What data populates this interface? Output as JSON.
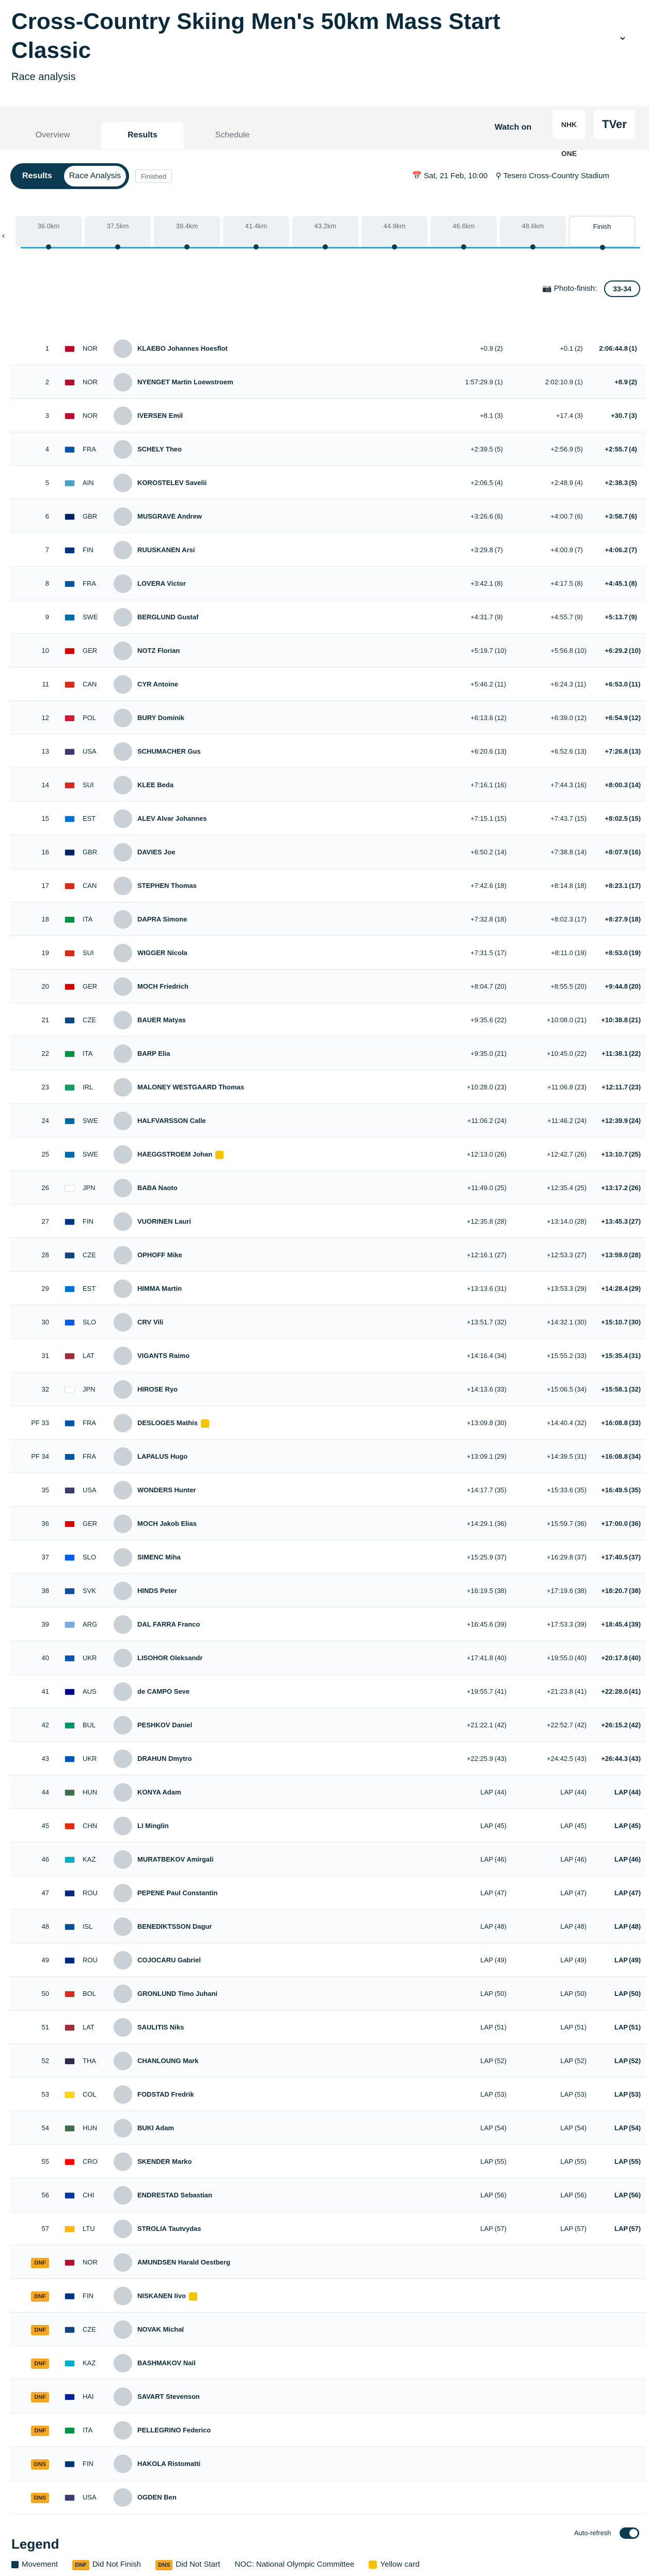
{
  "header": {
    "title": "Cross-Country Skiing Men's 50km Mass Start Classic",
    "subtitle": "Race analysis",
    "collapse_icon": "chevron-down-icon"
  },
  "tabs": [
    "Overview",
    "Results",
    "Schedule"
  ],
  "watch": {
    "label": "Watch on",
    "logo1": "NHK ONE",
    "logo2": "TVer"
  },
  "toolbar": {
    "view_results": "Results",
    "view_analysis": "Race Analysis",
    "status": "Finished",
    "date": "Sat, 21 Feb, 10:00",
    "venue": "Tesero Cross-Country Stadium"
  },
  "splits": [
    "36.0km",
    "37.5km",
    "39.4km",
    "41.4km",
    "43.2km",
    "44.9km",
    "46.6km",
    "48.6km",
    "Finish"
  ],
  "photo_finish": {
    "label": "Photo-finish:",
    "button": "33-34"
  },
  "results": [
    {
      "rank": "1",
      "noc": "NOR",
      "name": "KLAEBO Johannes Hoesflot",
      "mid": "+0.9",
      "midr": "(2)",
      "late": "+0.1",
      "later": "(2)",
      "fin": "2:06:44.8",
      "finr": "(1)",
      "flag": "#ba0c2f"
    },
    {
      "rank": "2",
      "noc": "NOR",
      "name": "NYENGET Martin Loewstroem",
      "mid": "1:57:29.9",
      "midr": "(1)",
      "late": "2:02:10.9",
      "later": "(1)",
      "fin": "+8.9",
      "finr": "(2)",
      "flag": "#ba0c2f"
    },
    {
      "rank": "3",
      "noc": "NOR",
      "name": "IVERSEN Emil",
      "mid": "+8.1",
      "midr": "(3)",
      "late": "+17.4",
      "later": "(3)",
      "fin": "+30.7",
      "finr": "(3)",
      "flag": "#ba0c2f"
    },
    {
      "rank": "4",
      "noc": "FRA",
      "name": "SCHELY Theo",
      "mid": "+2:39.5",
      "midr": "(5)",
      "late": "+2:56.9",
      "later": "(5)",
      "fin": "+2:55.7",
      "finr": "(4)",
      "flag": "#0055a4"
    },
    {
      "rank": "5",
      "noc": "AIN",
      "name": "KOROSTELEV Savelii",
      "mid": "+2:06.5",
      "midr": "(4)",
      "late": "+2:48.9",
      "later": "(4)",
      "fin": "+2:38.3",
      "finr": "(5)",
      "flag": "#4aa3c7"
    },
    {
      "rank": "6",
      "noc": "GBR",
      "name": "MUSGRAVE Andrew",
      "mid": "+3:26.6",
      "midr": "(6)",
      "late": "+4:00.7",
      "later": "(6)",
      "fin": "+3:58.7",
      "finr": "(6)",
      "flag": "#012169"
    },
    {
      "rank": "7",
      "noc": "FIN",
      "name": "RUUSKANEN Arsi",
      "mid": "+3:29.8",
      "midr": "(7)",
      "late": "+4:00.9",
      "later": "(7)",
      "fin": "+4:06.2",
      "finr": "(7)",
      "flag": "#003580"
    },
    {
      "rank": "8",
      "noc": "FRA",
      "name": "LOVERA Victor",
      "mid": "+3:42.1",
      "midr": "(8)",
      "late": "+4:17.5",
      "later": "(8)",
      "fin": "+4:45.1",
      "finr": "(8)",
      "flag": "#0055a4"
    },
    {
      "rank": "9",
      "noc": "SWE",
      "name": "BERGLUND Gustaf",
      "mid": "+4:31.7",
      "midr": "(9)",
      "late": "+4:55.7",
      "later": "(9)",
      "fin": "+5:13.7",
      "finr": "(9)",
      "flag": "#006aa7"
    },
    {
      "rank": "10",
      "noc": "GER",
      "name": "NOTZ Florian",
      "mid": "+5:19.7",
      "midr": "(10)",
      "late": "+5:56.8",
      "later": "(10)",
      "fin": "+6:29.2",
      "finr": "(10)",
      "flag": "#dd0000"
    },
    {
      "rank": "11",
      "noc": "CAN",
      "name": "CYR Antoine",
      "mid": "+5:46.2",
      "midr": "(11)",
      "late": "+6:24.3",
      "later": "(11)",
      "fin": "+6:53.0",
      "finr": "(11)",
      "flag": "#d52b1e"
    },
    {
      "rank": "12",
      "noc": "POL",
      "name": "BURY Dominik",
      "mid": "+6:13.6",
      "midr": "(12)",
      "late": "+6:39.0",
      "later": "(12)",
      "fin": "+6:54.9",
      "finr": "(12)",
      "flag": "#dc143c"
    },
    {
      "rank": "13",
      "noc": "USA",
      "name": "SCHUMACHER Gus",
      "mid": "+6:20.6",
      "midr": "(13)",
      "late": "+6:52.6",
      "later": "(13)",
      "fin": "+7:26.8",
      "finr": "(13)",
      "flag": "#3c3b6e"
    },
    {
      "rank": "14",
      "noc": "SUI",
      "name": "KLEE Beda",
      "mid": "+7:16.1",
      "midr": "(16)",
      "late": "+7:44.3",
      "later": "(16)",
      "fin": "+8:00.3",
      "finr": "(14)",
      "flag": "#d52b1e"
    },
    {
      "rank": "15",
      "noc": "EST",
      "name": "ALEV Alvar Johannes",
      "mid": "+7:15.1",
      "midr": "(15)",
      "late": "+7:43.7",
      "later": "(15)",
      "fin": "+8:02.5",
      "finr": "(15)",
      "flag": "#0072ce"
    },
    {
      "rank": "16",
      "noc": "GBR",
      "name": "DAVIES Joe",
      "mid": "+6:50.2",
      "midr": "(14)",
      "late": "+7:38.8",
      "later": "(14)",
      "fin": "+8:07.9",
      "finr": "(16)",
      "flag": "#012169"
    },
    {
      "rank": "17",
      "noc": "CAN",
      "name": "STEPHEN Thomas",
      "mid": "+7:42.6",
      "midr": "(18)",
      "late": "+8:14.8",
      "later": "(18)",
      "fin": "+8:23.1",
      "finr": "(17)",
      "flag": "#d52b1e"
    },
    {
      "rank": "18",
      "noc": "ITA",
      "name": "DAPRA Simone",
      "mid": "+7:32.8",
      "midr": "(18)",
      "late": "+8:02.3",
      "later": "(17)",
      "fin": "+8:27.9",
      "finr": "(18)",
      "flag": "#009246"
    },
    {
      "rank": "19",
      "noc": "SUI",
      "name": "WIGGER Nicola",
      "mid": "+7:31.5",
      "midr": "(17)",
      "late": "+8:11.0",
      "later": "(19)",
      "fin": "+8:53.0",
      "finr": "(19)",
      "flag": "#d52b1e"
    },
    {
      "rank": "20",
      "noc": "GER",
      "name": "MOCH Friedrich",
      "mid": "+8:04.7",
      "midr": "(20)",
      "late": "+8:55.5",
      "later": "(20)",
      "fin": "+9:44.8",
      "finr": "(20)",
      "flag": "#dd0000"
    },
    {
      "rank": "21",
      "noc": "CZE",
      "name": "BAUER Matyas",
      "mid": "+9:35.6",
      "midr": "(22)",
      "late": "+10:08.0",
      "later": "(21)",
      "fin": "+10:38.8",
      "finr": "(21)",
      "flag": "#11457e"
    },
    {
      "rank": "22",
      "noc": "ITA",
      "name": "BARP Elia",
      "mid": "+9:35.0",
      "midr": "(21)",
      "late": "+10:45.0",
      "later": "(22)",
      "fin": "+11:38.1",
      "finr": "(22)",
      "flag": "#009246"
    },
    {
      "rank": "23",
      "noc": "IRL",
      "name": "MALONEY WESTGAARD Thomas",
      "mid": "+10:28.0",
      "midr": "(23)",
      "late": "+11:06.8",
      "later": "(23)",
      "fin": "+12:11.7",
      "finr": "(23)",
      "flag": "#169b62"
    },
    {
      "rank": "24",
      "noc": "SWE",
      "name": "HALFVARSSON Calle",
      "mid": "+11:06.2",
      "midr": "(24)",
      "late": "+11:46.2",
      "later": "(24)",
      "fin": "+12:39.9",
      "finr": "(24)",
      "flag": "#006aa7"
    },
    {
      "rank": "25",
      "noc": "SWE",
      "name": "HAEGGSTROEM Johan",
      "mid": "+12:13.0",
      "midr": "(26)",
      "late": "+12:42.7",
      "later": "(26)",
      "fin": "+13:10.7",
      "finr": "(25)",
      "flag": "#006aa7",
      "yellow": true
    },
    {
      "rank": "26",
      "noc": "JPN",
      "name": "BABA Naoto",
      "mid": "+11:49.0",
      "midr": "(25)",
      "late": "+12:35.4",
      "later": "(25)",
      "fin": "+13:17.2",
      "finr": "(26)",
      "flag": "#ffffff"
    },
    {
      "rank": "27",
      "noc": "FIN",
      "name": "VUORINEN Lauri",
      "mid": "+12:35.8",
      "midr": "(28)",
      "late": "+13:14.0",
      "later": "(28)",
      "fin": "+13:45.3",
      "finr": "(27)",
      "flag": "#003580"
    },
    {
      "rank": "28",
      "noc": "CZE",
      "name": "OPHOFF Mike",
      "mid": "+12:16.1",
      "midr": "(27)",
      "late": "+12:53.3",
      "later": "(27)",
      "fin": "+13:59.0",
      "finr": "(28)",
      "flag": "#11457e"
    },
    {
      "rank": "29",
      "noc": "EST",
      "name": "HIMMA Martin",
      "mid": "+13:13.6",
      "midr": "(31)",
      "late": "+13:53.3",
      "later": "(29)",
      "fin": "+14:28.4",
      "finr": "(29)",
      "flag": "#0072ce"
    },
    {
      "rank": "30",
      "noc": "SLO",
      "name": "CRV Vili",
      "mid": "+13:51.7",
      "midr": "(32)",
      "late": "+14:32.1",
      "later": "(30)",
      "fin": "+15:10.7",
      "finr": "(30)",
      "flag": "#005ce6"
    },
    {
      "rank": "31",
      "noc": "LAT",
      "name": "VIGANTS Raimo",
      "mid": "+14:16.4",
      "midr": "(34)",
      "late": "+15:55.2",
      "later": "(33)",
      "fin": "+15:35.4",
      "finr": "(31)",
      "flag": "#9e3039"
    },
    {
      "rank": "32",
      "noc": "JPN",
      "name": "HIROSE Ryo",
      "mid": "+14:13.6",
      "midr": "(33)",
      "late": "+15:06.5",
      "later": "(34)",
      "fin": "+15:58.1",
      "finr": "(32)",
      "flag": "#ffffff"
    },
    {
      "rank": "PF 33",
      "noc": "FRA",
      "name": "DESLOGES Mathis",
      "mid": "+13:09.8",
      "midr": "(30)",
      "late": "+14:40.4",
      "later": "(32)",
      "fin": "+16:08.8",
      "finr": "(33)",
      "flag": "#0055a4",
      "yellow": true
    },
    {
      "rank": "PF 34",
      "noc": "FRA",
      "name": "LAPALUS Hugo",
      "mid": "+13:09.1",
      "midr": "(29)",
      "late": "+14:39.5",
      "later": "(31)",
      "fin": "+16:08.8",
      "finr": "(34)",
      "flag": "#0055a4"
    },
    {
      "rank": "35",
      "noc": "USA",
      "name": "WONDERS Hunter",
      "mid": "+14:17.7",
      "midr": "(35)",
      "late": "+15:33.6",
      "later": "(35)",
      "fin": "+16:49.5",
      "finr": "(35)",
      "flag": "#3c3b6e"
    },
    {
      "rank": "36",
      "noc": "GER",
      "name": "MOCH Jakob Elias",
      "mid": "+14:29.1",
      "midr": "(36)",
      "late": "+15:59.7",
      "later": "(36)",
      "fin": "+17:00.0",
      "finr": "(36)",
      "flag": "#dd0000"
    },
    {
      "rank": "37",
      "noc": "SLO",
      "name": "SIMENC Miha",
      "mid": "+15:25.9",
      "midr": "(37)",
      "late": "+16:29.8",
      "later": "(37)",
      "fin": "+17:40.5",
      "finr": "(37)",
      "flag": "#005ce6"
    },
    {
      "rank": "38",
      "noc": "SVK",
      "name": "HINDS Peter",
      "mid": "+16:19.5",
      "midr": "(38)",
      "late": "+17:19.6",
      "later": "(38)",
      "fin": "+18:20.7",
      "finr": "(38)",
      "flag": "#0b4ea2"
    },
    {
      "rank": "39",
      "noc": "ARG",
      "name": "DAL FARRA Franco",
      "mid": "+16:45.6",
      "midr": "(39)",
      "late": "+17:53.3",
      "later": "(39)",
      "fin": "+18:45.4",
      "finr": "(39)",
      "flag": "#74acdf"
    },
    {
      "rank": "40",
      "noc": "UKR",
      "name": "LISOHOR Oleksandr",
      "mid": "+17:41.8",
      "midr": "(40)",
      "late": "+19:55.0",
      "later": "(40)",
      "fin": "+20:17.8",
      "finr": "(40)",
      "flag": "#0057b7"
    },
    {
      "rank": "41",
      "noc": "AUS",
      "name": "de CAMPO Seve",
      "mid": "+19:55.7",
      "midr": "(41)",
      "late": "+21:23.8",
      "later": "(41)",
      "fin": "+22:28.0",
      "finr": "(41)",
      "flag": "#00008b"
    },
    {
      "rank": "42",
      "noc": "BUL",
      "name": "PESHKOV Daniel",
      "mid": "+21:22.1",
      "midr": "(42)",
      "late": "+22:52.7",
      "later": "(42)",
      "fin": "+26:15.2",
      "finr": "(42)",
      "flag": "#00966e"
    },
    {
      "rank": "43",
      "noc": "UKR",
      "name": "DRAHUN Dmytro",
      "mid": "+22:25.9",
      "midr": "(43)",
      "late": "+24:42.5",
      "later": "(43)",
      "fin": "+26:44.3",
      "finr": "(43)",
      "flag": "#0057b7"
    },
    {
      "rank": "44",
      "noc": "HUN",
      "name": "KONYA Adam",
      "mid": "LAP",
      "midr": "(44)",
      "late": "LAP",
      "later": "(44)",
      "fin": "LAP",
      "finr": "(44)",
      "flag": "#436f4d"
    },
    {
      "rank": "45",
      "noc": "CHN",
      "name": "LI Minglin",
      "mid": "LAP",
      "midr": "(45)",
      "late": "LAP",
      "later": "(45)",
      "fin": "LAP",
      "finr": "(45)",
      "flag": "#de2910"
    },
    {
      "rank": "46",
      "noc": "KAZ",
      "name": "MURATBEKOV Amirgali",
      "mid": "LAP",
      "midr": "(46)",
      "late": "LAP",
      "later": "(46)",
      "fin": "LAP",
      "finr": "(46)",
      "flag": "#00afca"
    },
    {
      "rank": "47",
      "noc": "ROU",
      "name": "PEPENE Paul Constantin",
      "mid": "LAP",
      "midr": "(47)",
      "late": "LAP",
      "later": "(47)",
      "fin": "LAP",
      "finr": "(47)",
      "flag": "#002b7f"
    },
    {
      "rank": "48",
      "noc": "ISL",
      "name": "BENEDIKTSSON Dagur",
      "mid": "LAP",
      "midr": "(48)",
      "late": "LAP",
      "later": "(48)",
      "fin": "LAP",
      "finr": "(48)",
      "flag": "#02529c"
    },
    {
      "rank": "49",
      "noc": "ROU",
      "name": "COJOCARU Gabriel",
      "mid": "LAP",
      "midr": "(49)",
      "late": "LAP",
      "later": "(49)",
      "fin": "LAP",
      "finr": "(49)",
      "flag": "#002b7f"
    },
    {
      "rank": "50",
      "noc": "BOL",
      "name": "GRONLUND Timo Juhani",
      "mid": "LAP",
      "midr": "(50)",
      "late": "LAP",
      "later": "(50)",
      "fin": "LAP",
      "finr": "(50)",
      "flag": "#d52b1e"
    },
    {
      "rank": "51",
      "noc": "LAT",
      "name": "SAULITIS Niks",
      "mid": "LAP",
      "midr": "(51)",
      "late": "LAP",
      "later": "(51)",
      "fin": "LAP",
      "finr": "(51)",
      "flag": "#9e3039"
    },
    {
      "rank": "52",
      "noc": "THA",
      "name": "CHANLOUNG Mark",
      "mid": "LAP",
      "midr": "(52)",
      "late": "LAP",
      "later": "(52)",
      "fin": "LAP",
      "finr": "(52)",
      "flag": "#2d2a4a"
    },
    {
      "rank": "53",
      "noc": "COL",
      "name": "FODSTAD Fredrik",
      "mid": "LAP",
      "midr": "(53)",
      "late": "LAP",
      "later": "(53)",
      "fin": "LAP",
      "finr": "(53)",
      "flag": "#fcd116"
    },
    {
      "rank": "54",
      "noc": "HUN",
      "name": "BUKI Adam",
      "mid": "LAP",
      "midr": "(54)",
      "late": "LAP",
      "later": "(54)",
      "fin": "LAP",
      "finr": "(54)",
      "flag": "#436f4d"
    },
    {
      "rank": "55",
      "noc": "CRO",
      "name": "SKENDER Marko",
      "mid": "LAP",
      "midr": "(55)",
      "late": "LAP",
      "later": "(55)",
      "fin": "LAP",
      "finr": "(55)",
      "flag": "#ff0000"
    },
    {
      "rank": "56",
      "noc": "CHI",
      "name": "ENDRESTAD Sebastian",
      "mid": "LAP",
      "midr": "(56)",
      "late": "LAP",
      "later": "(56)",
      "fin": "LAP",
      "finr": "(56)",
      "flag": "#0039a6"
    },
    {
      "rank": "57",
      "noc": "LTU",
      "name": "STROLIA Tautvydas",
      "mid": "LAP",
      "midr": "(57)",
      "late": "LAP",
      "later": "(57)",
      "fin": "LAP",
      "finr": "(57)",
      "flag": "#fdb913"
    },
    {
      "rank": "DNF",
      "noc": "NOR",
      "name": "AMUNDSEN Harald Oestberg",
      "mid": "",
      "midr": "",
      "late": "",
      "later": "",
      "fin": "",
      "finr": "",
      "flag": "#ba0c2f",
      "badge": true
    },
    {
      "rank": "DNF",
      "noc": "FIN",
      "name": "NISKANEN Iivo",
      "mid": "",
      "midr": "",
      "late": "",
      "later": "",
      "fin": "",
      "finr": "",
      "flag": "#003580",
      "badge": true,
      "yellow": true
    },
    {
      "rank": "DNF",
      "noc": "CZE",
      "name": "NOVAK Michal",
      "mid": "",
      "midr": "",
      "late": "",
      "later": "",
      "fin": "",
      "finr": "",
      "flag": "#11457e",
      "badge": true
    },
    {
      "rank": "DNF",
      "noc": "KAZ",
      "name": "BASHMAKOV Nail",
      "mid": "",
      "midr": "",
      "late": "",
      "later": "",
      "fin": "",
      "finr": "",
      "flag": "#00afca",
      "badge": true
    },
    {
      "rank": "DNF",
      "noc": "HAI",
      "name": "SAVART Stevenson",
      "mid": "",
      "midr": "",
      "late": "",
      "later": "",
      "fin": "",
      "finr": "",
      "flag": "#00209f",
      "badge": true
    },
    {
      "rank": "DNF",
      "noc": "ITA",
      "name": "PELLEGRINO Federico",
      "mid": "",
      "midr": "",
      "late": "",
      "later": "",
      "fin": "",
      "finr": "",
      "flag": "#009246",
      "badge": true
    },
    {
      "rank": "DNS",
      "noc": "FIN",
      "name": "HAKOLA Ristomatti",
      "mid": "",
      "midr": "",
      "late": "",
      "later": "",
      "fin": "",
      "finr": "",
      "flag": "#003580",
      "badge": true
    },
    {
      "rank": "DNS",
      "noc": "USA",
      "name": "OGDEN Ben",
      "mid": "",
      "midr": "",
      "late": "",
      "later": "",
      "fin": "",
      "finr": "",
      "flag": "#3c3b6e",
      "badge": true
    }
  ],
  "auto_refresh": "Auto-refresh",
  "legend": {
    "title": "Legend",
    "items": [
      {
        "key": "",
        "label": "Movement"
      },
      {
        "key": "DNF",
        "label": "Did Not Finish"
      },
      {
        "key": "DNS",
        "label": "Did Not Start"
      },
      {
        "key": "",
        "label": "NOC: National Olympic Committee"
      },
      {
        "key": "",
        "label": "Yellow card"
      }
    ]
  }
}
